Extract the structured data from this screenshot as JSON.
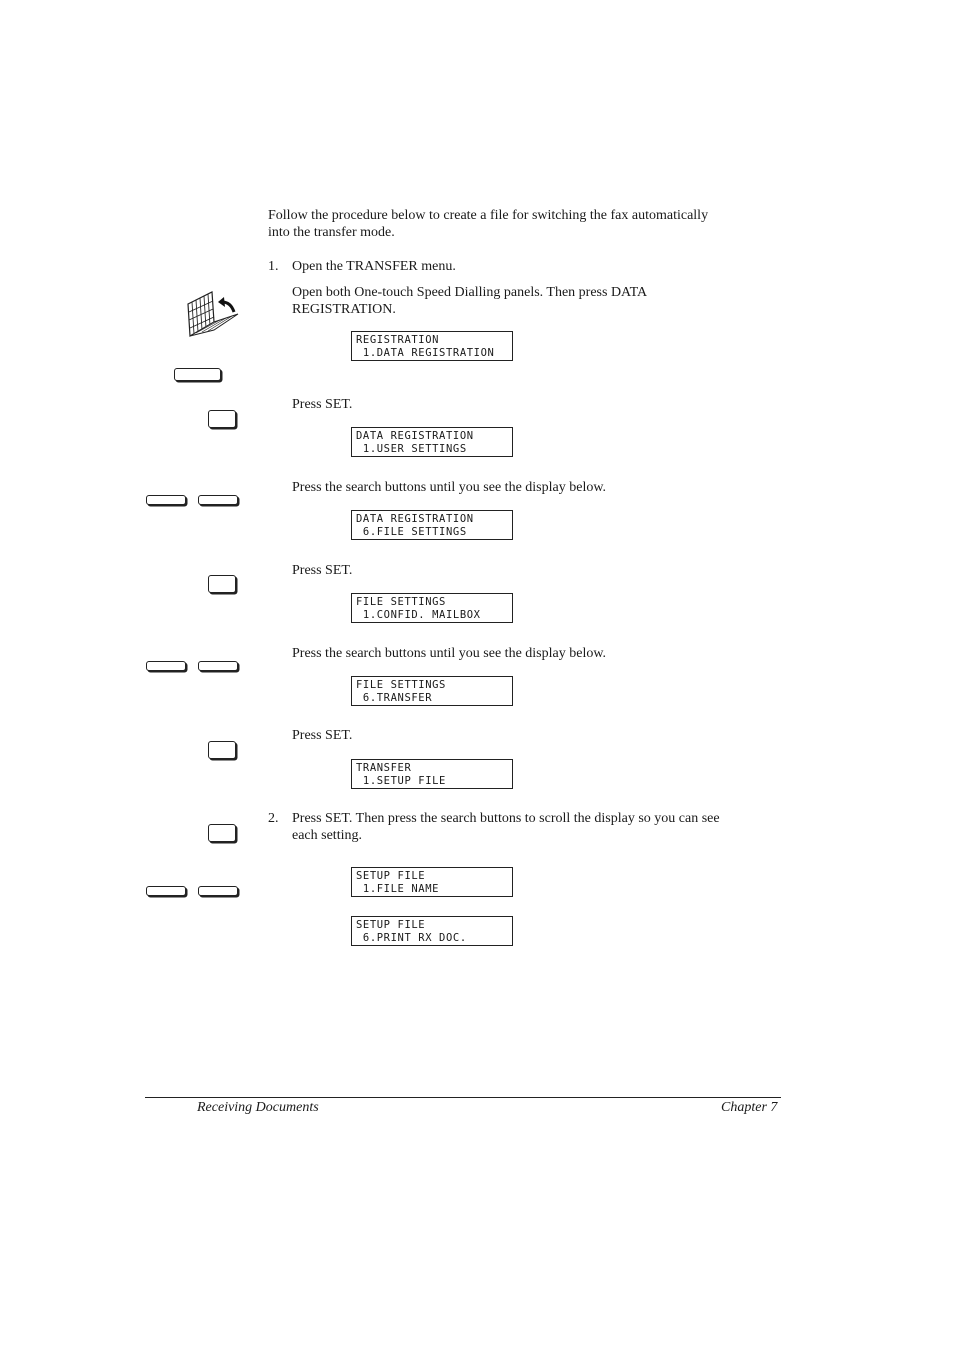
{
  "intro": {
    "line1": "Follow the procedure below to create a file for switching the fax automatically",
    "line2": "into the transfer mode."
  },
  "steps": [
    {
      "number": "1.",
      "title": "Open the TRANSFER menu.",
      "instruction_line1": "Open both One-touch Speed Dialling panels. Then press DATA",
      "instruction_line2": "REGISTRATION."
    },
    {
      "number": "2.",
      "line1": "Press SET. Then press the search buttons to scroll the display so you can see",
      "line2": "each setting."
    }
  ],
  "instructions": {
    "press_set": "Press SET.",
    "press_search": "Press the search buttons until you see the display below."
  },
  "displays": [
    {
      "line1": "REGISTRATION",
      "line2": " 1.DATA REGISTRATION"
    },
    {
      "line1": "DATA REGISTRATION",
      "line2": " 1.USER SETTINGS"
    },
    {
      "line1": "DATA REGISTRATION",
      "line2": " 6.FILE SETTINGS"
    },
    {
      "line1": "FILE SETTINGS",
      "line2": " 1.CONFID. MAILBOX"
    },
    {
      "line1": "FILE SETTINGS",
      "line2": " 6.TRANSFER"
    },
    {
      "line1": "TRANSFER",
      "line2": " 1.SETUP FILE"
    },
    {
      "line1": "SETUP FILE",
      "line2": " 1.FILE NAME"
    },
    {
      "line1": "SETUP FILE",
      "line2": " 6.PRINT RX DOC."
    }
  ],
  "footer": {
    "left": "Receiving Documents",
    "right": "Chapter 7"
  }
}
